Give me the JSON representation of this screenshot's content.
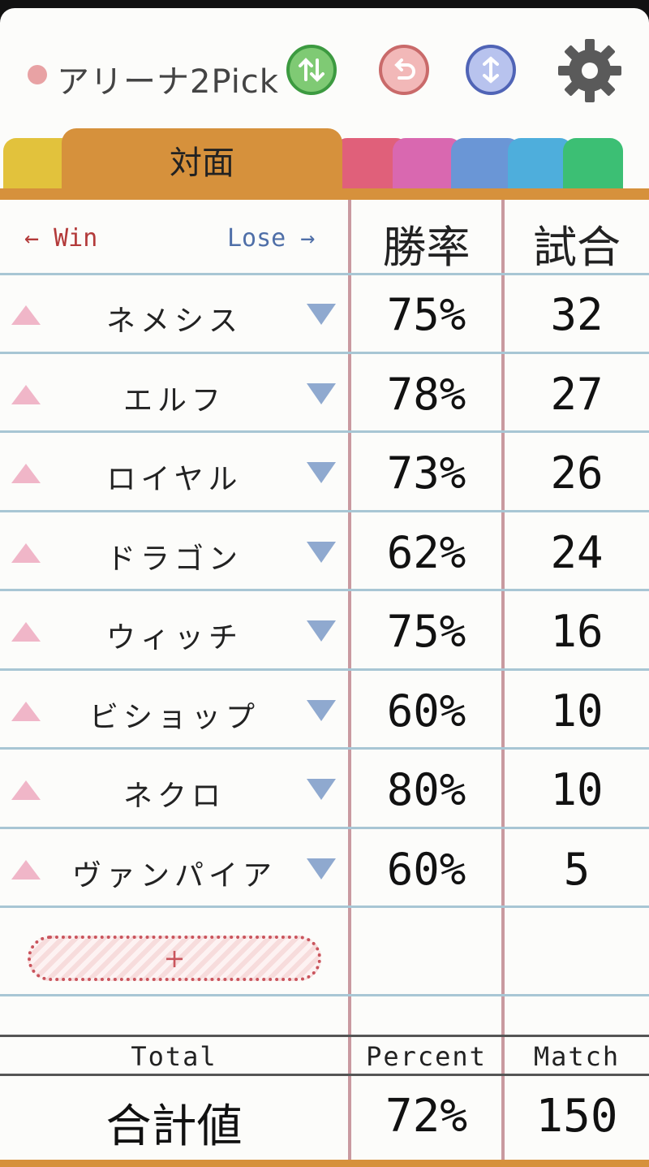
{
  "header": {
    "title": "アリーナ2Pick"
  },
  "icons": {
    "sort": "sort-arrows-icon",
    "undo": "undo-icon",
    "swap": "swap-vertical-icon",
    "settings": "gear-icon"
  },
  "tabs": {
    "active_label": "対面"
  },
  "table": {
    "win_label": "← Win",
    "lose_label": "Lose →",
    "rate_header": "勝率",
    "match_header": "試合",
    "rows": [
      {
        "name": "ネメシス",
        "rate": "75%",
        "matches": "32"
      },
      {
        "name": "エルフ",
        "rate": "78%",
        "matches": "27"
      },
      {
        "name": "ロイヤル",
        "rate": "73%",
        "matches": "26"
      },
      {
        "name": "ドラゴン",
        "rate": "62%",
        "matches": "24"
      },
      {
        "name": "ウィッチ",
        "rate": "75%",
        "matches": "16"
      },
      {
        "name": "ビショップ",
        "rate": "60%",
        "matches": "10"
      },
      {
        "name": "ネクロ",
        "rate": "80%",
        "matches": "10"
      },
      {
        "name": "ヴァンパイア",
        "rate": "60%",
        "matches": "5"
      }
    ],
    "add_label": "+"
  },
  "totals": {
    "total_label": "Total",
    "percent_label": "Percent",
    "match_label": "Match",
    "name": "合計値",
    "rate": "72%",
    "matches": "150"
  },
  "colors": {
    "accent_tab": "#d6913c",
    "tab_colors": [
      "#e2c23c",
      "#d6913c",
      "#e0607a",
      "#d968b0",
      "#6a96d6",
      "#4eaedc",
      "#3cbf74"
    ]
  }
}
